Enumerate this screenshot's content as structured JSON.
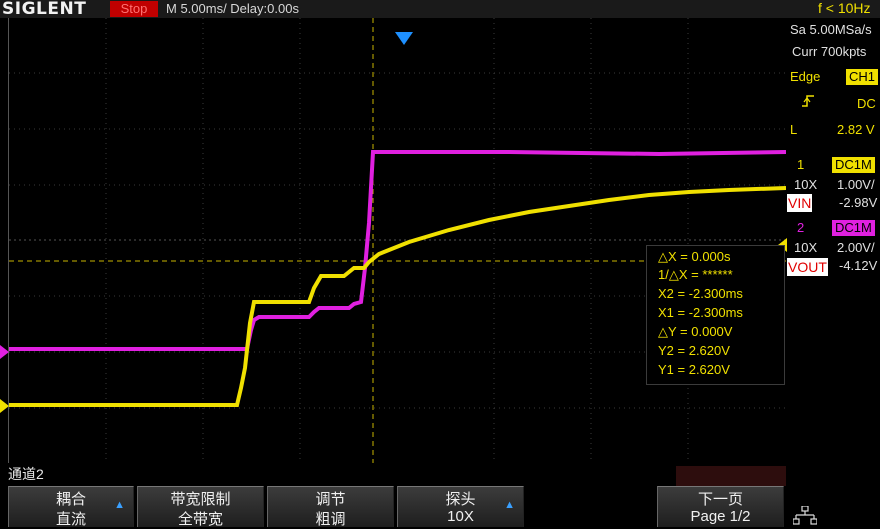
{
  "header": {
    "logo": "SIGLENT",
    "run_status": "Stop",
    "timebase": "M 5.00ms/ Delay:0.00s",
    "trigger_freq": "f < 10Hz"
  },
  "acquisition": {
    "sample_rate": "Sa 5.00MSa/s",
    "memory": "Curr 700kpts"
  },
  "trigger": {
    "type": "Edge",
    "source": "CH1",
    "coupling": "DC",
    "mode": "L",
    "level": "2.82 V"
  },
  "channels": [
    {
      "num": "1",
      "coupling": "DC1M",
      "probe": "10X",
      "scale": "1.00V/",
      "offset": "-2.98V",
      "label": "VIN",
      "color": "#f0e000"
    },
    {
      "num": "2",
      "coupling": "DC1M",
      "probe": "10X",
      "scale": "2.00V/",
      "offset": "-4.12V",
      "label": "VOUT",
      "color": "#e020e0"
    }
  ],
  "cursor_measure": {
    "dx": "△X = 0.000s",
    "inv_dx": "1/△X = ******",
    "x2": "X2 = -2.300ms",
    "x1": "X1 = -2.300ms",
    "dy": "△Y = 0.000V",
    "y2": "Y2 = 2.620V",
    "y1": "Y1 = 2.620V"
  },
  "menu": {
    "title": "通道2",
    "softkeys": [
      {
        "line1": "耦合",
        "line2": "直流"
      },
      {
        "line1": "带宽限制",
        "line2": "全带宽"
      },
      {
        "line1": "调节",
        "line2": "粗调"
      },
      {
        "line1": "探头",
        "line2": "10X"
      },
      {
        "line1": "下一页",
        "line2": "Page 1/2"
      }
    ]
  },
  "colors": {
    "ch1": "#f0e000",
    "ch2": "#e020e0",
    "accent": "#1e90ff",
    "stop": "#c00000"
  }
}
